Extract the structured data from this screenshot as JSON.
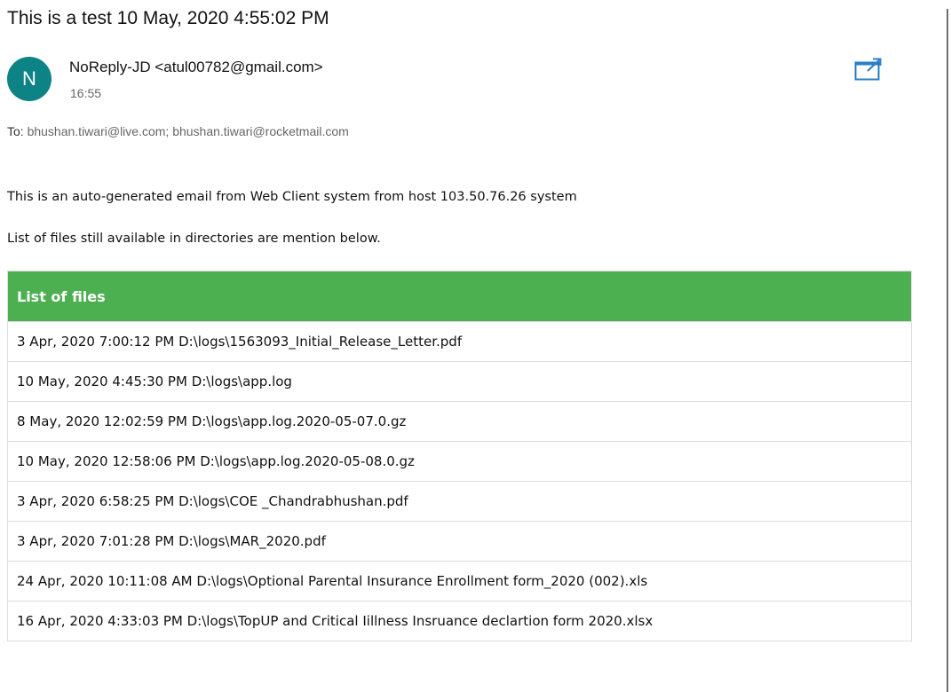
{
  "email": {
    "subject": "This is a test 10 May, 2020 4:55:02 PM",
    "avatar_letter": "N",
    "avatar_color": "#0e8386",
    "sender": "NoReply-JD <atul00782@gmail.com>",
    "time": "16:55",
    "popout_icon": "open-in-new-window-icon",
    "to_label": "To:",
    "to_addresses": "bhushan.tiwari@live.com; bhushan.tiwari@rocketmail.com",
    "body_line1": "This is an auto-generated email from Web Client system from host 103.50.76.26 system",
    "body_line2": "List of files still available in directories are mention below."
  },
  "table": {
    "header": "List of files",
    "header_color": "#4caf50",
    "rows": [
      "3 Apr, 2020 7:00:12 PM D:\\logs\\1563093_Initial_Release_Letter.pdf",
      "10 May, 2020 4:45:30 PM D:\\logs\\app.log",
      "8 May, 2020 12:02:59 PM D:\\logs\\app.log.2020-05-07.0.gz",
      "10 May, 2020 12:58:06 PM D:\\logs\\app.log.2020-05-08.0.gz",
      "3 Apr, 2020 6:58:25 PM D:\\logs\\COE _Chandrabhushan.pdf",
      "3 Apr, 2020 7:01:28 PM D:\\logs\\MAR_2020.pdf",
      "24 Apr, 2020 10:11:08 AM D:\\logs\\Optional Parental Insurance Enrollment form_2020 (002).xls",
      "16 Apr, 2020 4:33:03 PM D:\\logs\\TopUP and Critical Iillness Insruance declartion form 2020.xlsx"
    ]
  }
}
